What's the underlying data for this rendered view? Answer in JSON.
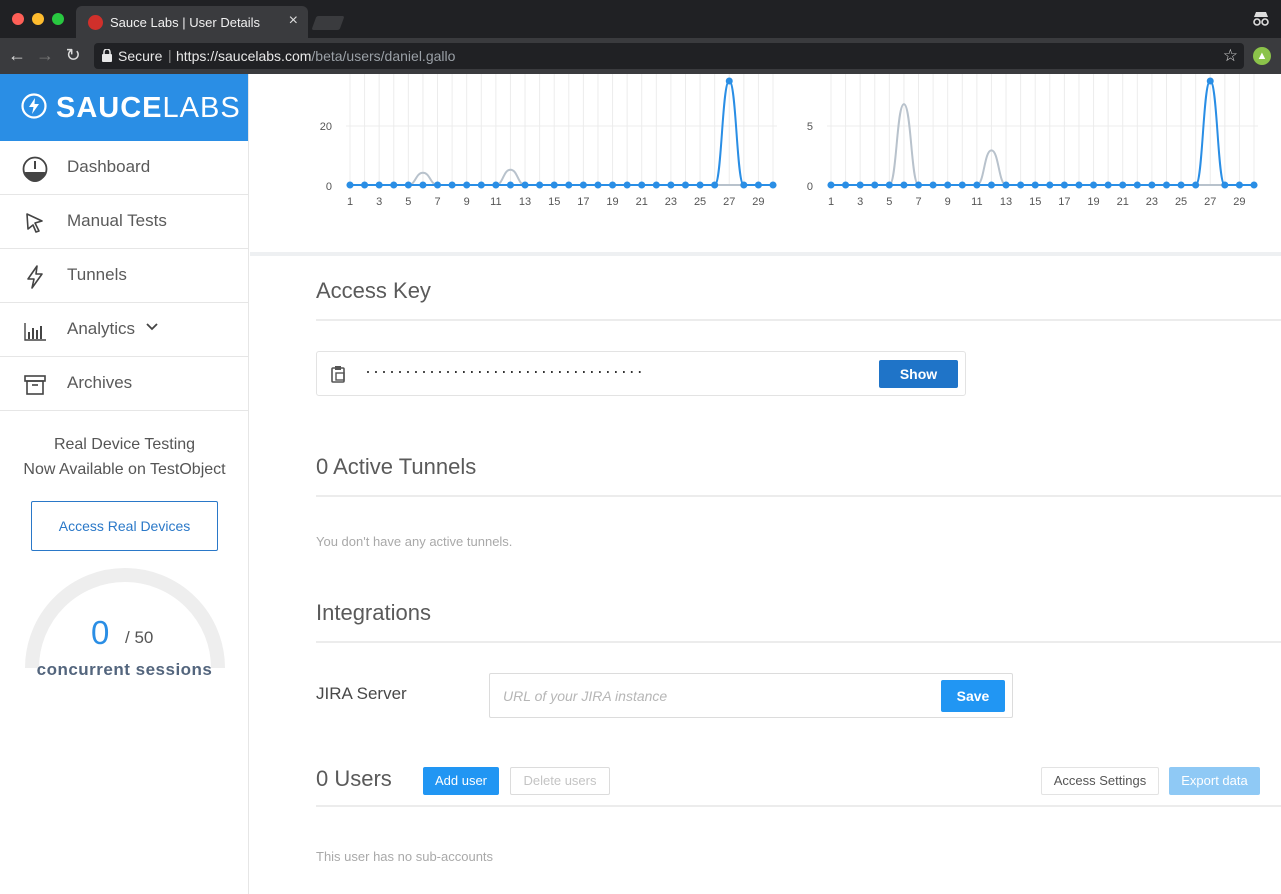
{
  "browser": {
    "tab_title": "Sauce Labs | User Details",
    "tab_close": "×",
    "secure_label": "Secure",
    "separator": "|",
    "url_host": "https://saucelabs.com",
    "url_path": "/beta/users/daniel.gallo",
    "favicon_color": "#d0302b"
  },
  "sidebar": {
    "brand": {
      "bold": "SAUCE",
      "light": "LABS",
      "color": "#2a8ee5"
    },
    "items": [
      {
        "label": "Dashboard",
        "icon": "dashboard-icon"
      },
      {
        "label": "Manual Tests",
        "icon": "cursor-icon"
      },
      {
        "label": "Tunnels",
        "icon": "lightning-icon"
      },
      {
        "label": "Analytics",
        "icon": "bar-chart-icon",
        "has_dropdown": true
      },
      {
        "label": "Archives",
        "icon": "archive-icon"
      }
    ],
    "promo_line1": "Real Device Testing",
    "promo_line2": "Now Available on TestObject",
    "promo_button": "Access Real Devices",
    "sessions": {
      "current": "0",
      "max": "/ 50",
      "label": "concurrent sessions",
      "fraction": 0
    }
  },
  "charts": {
    "left": {
      "ytick_labels": [
        "0",
        "20"
      ],
      "xtick_labels": [
        "1",
        "3",
        "5",
        "7",
        "9",
        "11",
        "13",
        "15",
        "17",
        "19",
        "21",
        "23",
        "25",
        "27",
        "29"
      ]
    },
    "right": {
      "ytick_labels": [
        "0",
        "5"
      ],
      "xtick_labels": [
        "1",
        "3",
        "5",
        "7",
        "9",
        "11",
        "13",
        "15",
        "17",
        "19",
        "21",
        "23",
        "25",
        "27",
        "29"
      ]
    }
  },
  "chart_data": [
    {
      "type": "line",
      "x": [
        1,
        2,
        3,
        4,
        5,
        6,
        7,
        8,
        9,
        10,
        11,
        12,
        13,
        14,
        15,
        16,
        17,
        18,
        19,
        20,
        21,
        22,
        23,
        24,
        25,
        26,
        27,
        28,
        29,
        30
      ],
      "series": [
        {
          "values": [
            0,
            0,
            0,
            0,
            0,
            0,
            0,
            0,
            0,
            0,
            0,
            0,
            0,
            0,
            0,
            0,
            0,
            0,
            0,
            0,
            0,
            0,
            0,
            0,
            0,
            0,
            34,
            0,
            0,
            0
          ],
          "color": "#2a8ee5"
        },
        {
          "values": [
            0,
            0,
            0,
            0,
            0,
            4,
            0,
            0,
            0,
            0,
            0,
            5,
            0,
            0,
            0,
            0,
            0,
            0,
            0,
            0,
            0,
            0,
            0,
            0,
            0,
            0,
            0,
            0,
            0,
            0
          ],
          "color": "#b8c2cc"
        }
      ],
      "ylim": [
        0,
        34
      ]
    },
    {
      "type": "line",
      "x": [
        1,
        2,
        3,
        4,
        5,
        6,
        7,
        8,
        9,
        10,
        11,
        12,
        13,
        14,
        15,
        16,
        17,
        18,
        19,
        20,
        21,
        22,
        23,
        24,
        25,
        26,
        27,
        28,
        29,
        30
      ],
      "series": [
        {
          "values": [
            0,
            0,
            0,
            0,
            0,
            0,
            0,
            0,
            0,
            0,
            0,
            0,
            0,
            0,
            0,
            0,
            0,
            0,
            0,
            0,
            0,
            0,
            0,
            0,
            0,
            0,
            9,
            0,
            0,
            0
          ],
          "color": "#2a8ee5"
        },
        {
          "values": [
            0,
            0,
            0,
            0,
            0,
            7,
            0,
            0,
            0,
            0,
            0,
            3,
            0,
            0,
            0,
            0,
            0,
            0,
            0,
            0,
            0,
            0,
            0,
            0,
            0,
            0,
            0,
            0,
            0,
            0
          ],
          "color": "#b8c2cc"
        }
      ],
      "ylim": [
        0,
        9
      ]
    }
  ],
  "access_key": {
    "title": "Access Key",
    "masked": "···································",
    "show_button": "Show"
  },
  "tunnels": {
    "title": "0 Active Tunnels",
    "empty_text": "You don't have any active tunnels."
  },
  "integrations": {
    "title": "Integrations",
    "jira_label": "JIRA Server",
    "jira_placeholder": "URL of your JIRA instance",
    "jira_value": "",
    "save_button": "Save"
  },
  "users": {
    "title": "0 Users",
    "add_button": "Add user",
    "delete_button": "Delete users",
    "access_settings_button": "Access Settings",
    "export_button": "Export data",
    "empty_text": "This user has no sub-accounts"
  }
}
